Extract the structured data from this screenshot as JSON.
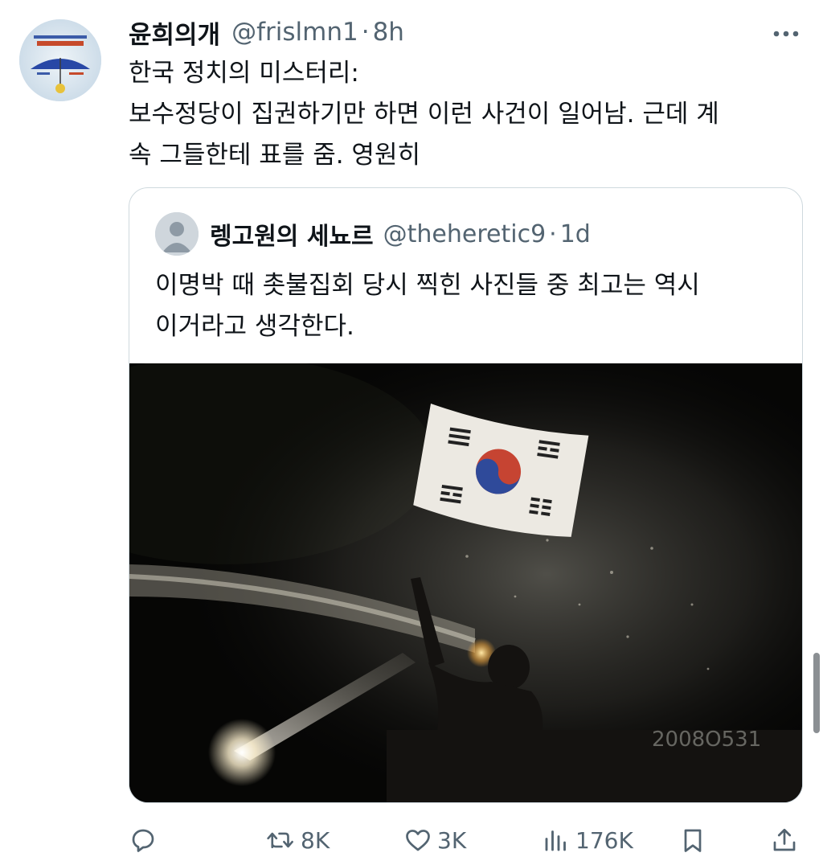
{
  "post": {
    "author_name": "윤희의개",
    "author_handle": "@frislmn1",
    "separator": "·",
    "time": "8h",
    "text_lines": [
      "한국 정치의 미스터리:",
      "보수정당이 집권하기만 하면 이런 사건이 일어남. 근데 계",
      "속 그들한테 표를 줌. 영원히"
    ]
  },
  "quoted": {
    "author_name": "렝고원의 세뇨르",
    "author_handle": "@theheretic9",
    "separator": "·",
    "time": "1d",
    "text_lines": [
      "이명박 때 촛불집회 당시 찍힌 사진들 중 최고는 역시",
      "이거라고 생각한다."
    ],
    "photo_watermark": "2008O531"
  },
  "actions": {
    "reply": {
      "icon": "reply-icon",
      "count": ""
    },
    "repost": {
      "icon": "repost-icon",
      "count": "8K"
    },
    "like": {
      "icon": "heart-icon",
      "count": "3K"
    },
    "views": {
      "icon": "views-icon",
      "count": "176K"
    },
    "bookmark": {
      "icon": "bookmark-icon",
      "count": ""
    },
    "share": {
      "icon": "share-icon",
      "count": ""
    }
  },
  "colors": {
    "text_primary": "#0f1419",
    "text_secondary": "#536471",
    "border": "#cfd9de"
  }
}
